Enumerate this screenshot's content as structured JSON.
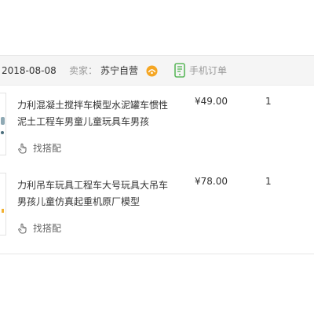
{
  "order": {
    "date": "2018-08-08",
    "seller_label": "卖家：",
    "seller_name": "苏宁自营",
    "store_icon": "suning-orange-icon",
    "mobile_icon": "phone-icon",
    "mobile_order_label": "手机订单"
  },
  "items": [
    {
      "title": "力利混凝土搅拌车模型水泥罐车惯性泥土工程车男童儿童玩具车男孩",
      "price": "¥49.00",
      "quantity": "1",
      "action_label": "找搭配",
      "action_icon": "hand-pointer-icon"
    },
    {
      "title": "力利吊车玩具工程车大号玩具大吊车 男孩儿童仿真起重机原厂模型",
      "price": "¥78.00",
      "quantity": "1",
      "action_label": "找搭配",
      "action_icon": "hand-pointer-icon"
    }
  ],
  "colors": {
    "header_bg": "#f5f5f5",
    "store_icon": "#f5a623",
    "mobile_icon": "#5cb85c",
    "muted_text": "#999999"
  }
}
